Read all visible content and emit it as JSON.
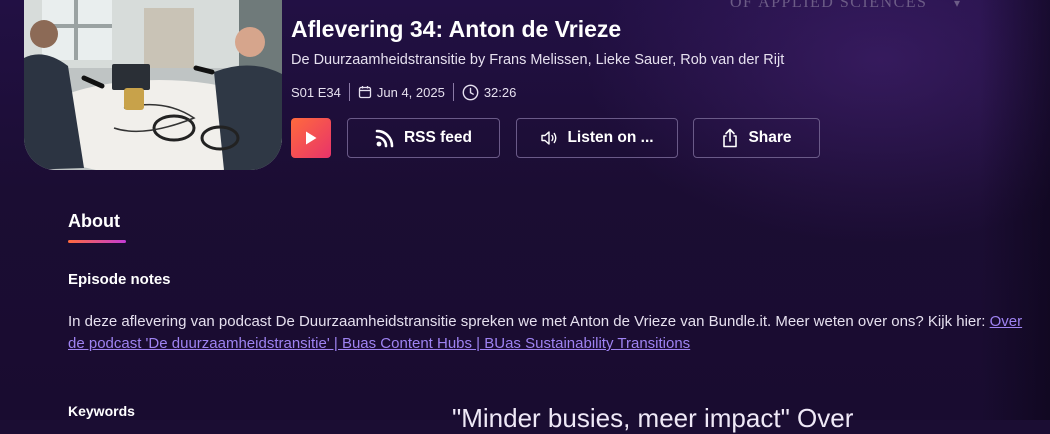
{
  "brand": {
    "wordmark": "OF APPLIED SCIENCES"
  },
  "episode": {
    "title": "Aflevering 34: Anton de Vrieze",
    "byline": "De Duurzaamheidstransitie by Frans Melissen, Lieke Sauer, Rob van der Rijt",
    "season_episode": "S01 E34",
    "date": "Jun 4, 2025",
    "duration": "32:26"
  },
  "actions": {
    "rss_label": "RSS feed",
    "listen_label": "Listen on ...",
    "share_label": "Share"
  },
  "about": {
    "heading": "About",
    "notes_heading": "Episode notes",
    "notes_text": "In deze aflevering van podcast De Duurzaamheidstransitie spreken we met Anton de Vrieze van Bundle.it. Meer weten over ons? Kijk hier: ",
    "notes_link": "Over de podcast 'De duurzaamheidstransitie' | Buas Content Hubs | BUas Sustainability Transitions",
    "keywords_heading": "Keywords",
    "quote_preview": "\"Minder busies, meer impact\" Over"
  },
  "colors": {
    "background": "#1b0d33",
    "accent_from": "#ff6a3d",
    "accent_to": "#e8336a",
    "link": "#9f83f2"
  },
  "icons": [
    "play-icon",
    "rss-icon",
    "speaker-icon",
    "share-icon",
    "calendar-icon",
    "clock-icon",
    "chevron-down-icon"
  ]
}
